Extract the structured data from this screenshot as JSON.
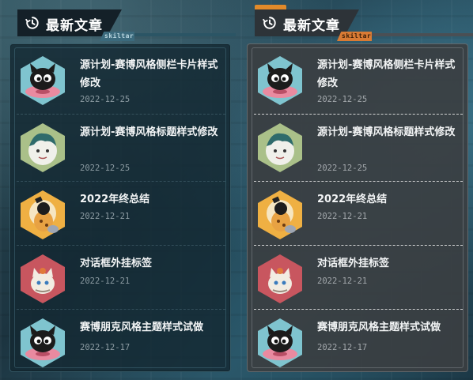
{
  "widget": {
    "title": "最新文章",
    "tag": "skiltar",
    "icon": "history-clock-icon"
  },
  "articles": [
    {
      "title": "源计划-赛博风格侧栏卡片样式修改",
      "date": "2022-12-25",
      "thumb": "black-cat-donut",
      "color": "#7fc4cf"
    },
    {
      "title": "源计划-赛博风格标题样式修改",
      "date": "2022-12-25",
      "thumb": "teal-hair-character",
      "color": "#aac089"
    },
    {
      "title": "2022年终总结",
      "date": "2022-12-21",
      "thumb": "orange-dog-character",
      "color": "#efb043"
    },
    {
      "title": "对话框外挂标签",
      "date": "2022-12-21",
      "thumb": "cat-with-paw",
      "color": "#c8565f"
    },
    {
      "title": "赛博朋克风格主题样式试做",
      "date": "2022-12-17",
      "thumb": "black-cat-donut",
      "color": "#7fc4cf"
    }
  ],
  "themes": [
    "dark-blue",
    "dark-gray"
  ]
}
